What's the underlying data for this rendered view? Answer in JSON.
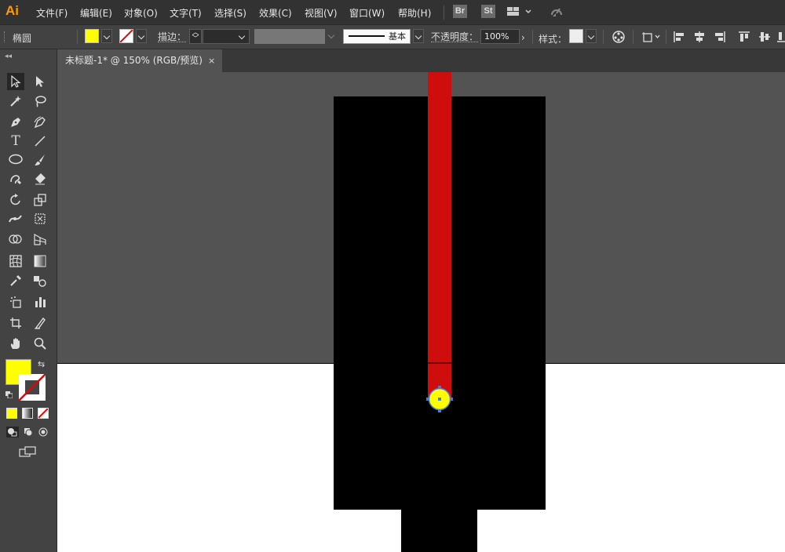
{
  "app": {
    "logo": "Ai"
  },
  "menubar": {
    "items": [
      "文件(F)",
      "编辑(E)",
      "对象(O)",
      "文字(T)",
      "选择(S)",
      "效果(C)",
      "视图(V)",
      "窗口(W)",
      "帮助(H)"
    ],
    "bridge_badge": "Br",
    "stock_badge": "St"
  },
  "controlbar": {
    "selection_name": "椭圆",
    "fill_color": "#ffff00",
    "stroke_label": "描边：",
    "stroke_profile": "基本",
    "opacity_label": "不透明度：",
    "opacity_value": "100%",
    "style_label": "样式："
  },
  "document": {
    "tab_title": "未标题-1* @ 150% (RGB/预览)",
    "close_glyph": "×"
  },
  "colors": {
    "pasteboard": "#535353",
    "artboard": "#ffffff",
    "shape_black": "#000000",
    "shape_red": "#cf0d0d",
    "ellipse_fill": "#ffff00",
    "selection_handle": "#4b7bd8"
  },
  "tools": {
    "fill_color": "#ffff00",
    "type_tool_glyph": "T"
  }
}
